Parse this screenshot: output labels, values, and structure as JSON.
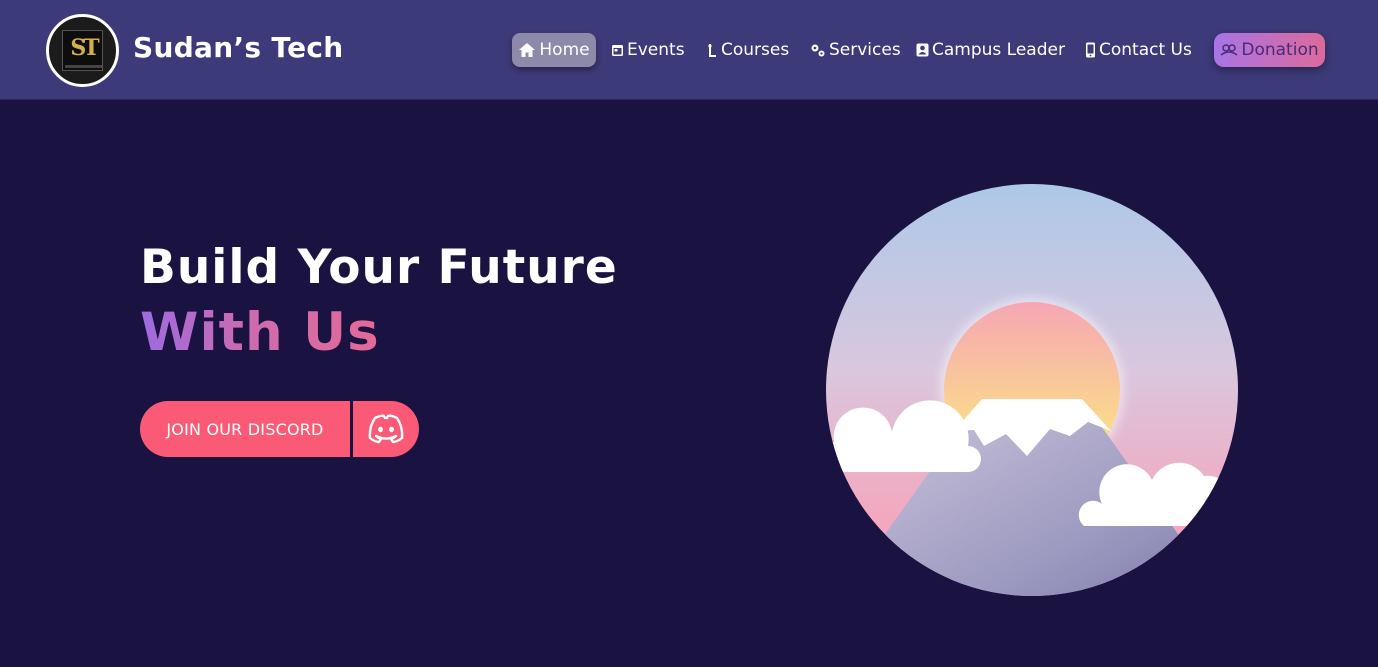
{
  "brand": {
    "name": "Sudan’s Tech",
    "logo_letters": "ST"
  },
  "nav": {
    "home": "Home",
    "events": "Events",
    "courses": "Courses",
    "services": "Services",
    "campus_leader": "Campus Leader",
    "contact": "Contact Us",
    "donation": "Donation"
  },
  "hero": {
    "title_line1": "Build Your Future",
    "title_line2": "With Us",
    "cta_label": "JOIN OUR DISCORD"
  },
  "icons": {
    "home": "home-icon",
    "events": "calendar-icon",
    "courses": "ladder-icon",
    "services": "gears-icon",
    "campus": "id-badge-icon",
    "contact": "mobile-icon",
    "donation": "hands-heart-icon",
    "discord": "discord-icon"
  },
  "colors": {
    "navbar": "#3c3a78",
    "background": "#1a1240",
    "cta": "#fb5a76",
    "gradient_start": "#9d6be0",
    "gradient_end": "#e56a96"
  }
}
